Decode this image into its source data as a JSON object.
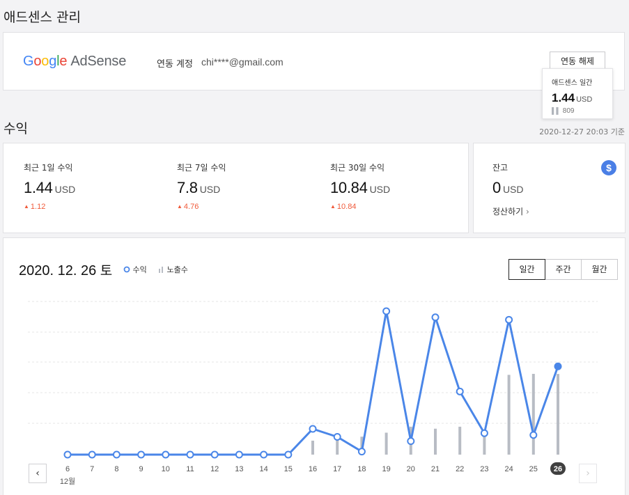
{
  "page": {
    "title": "애드센스 관리",
    "revenue_title": "수익",
    "timestamp": "2020-12-27 20:03 기준"
  },
  "account": {
    "logo_google": [
      "G",
      "o",
      "o",
      "g",
      "l",
      "e"
    ],
    "logo_product": "AdSense",
    "link_label": "연동 계정",
    "email": "chi****@gmail.com",
    "unlink_button": "연동 해제"
  },
  "stats": [
    {
      "label": "최근 1일 수익",
      "value": "1.44",
      "unit": "USD",
      "change": "1.12"
    },
    {
      "label": "최근 7일 수익",
      "value": "7.8",
      "unit": "USD",
      "change": "4.76"
    },
    {
      "label": "최근 30일 수익",
      "value": "10.84",
      "unit": "USD",
      "change": "10.84"
    }
  ],
  "balance": {
    "label": "잔고",
    "value": "0",
    "unit": "USD",
    "settle_link": "정산하기"
  },
  "chart_header": {
    "date": "2020. 12. 26",
    "weekday": "토",
    "legend_revenue": "수익",
    "legend_impressions": "노출수",
    "tabs": [
      "일간",
      "주간",
      "월간"
    ],
    "active_tab": "일간"
  },
  "tooltip": {
    "title": "애드센스 일간",
    "value": "1.44",
    "unit": "USD",
    "impressions": "809"
  },
  "colors": {
    "line": "#4a86e8",
    "impression_bar": "#b8bcc4",
    "up_change": "#f05a3a",
    "selected_day_bg": "#404040"
  },
  "chart_data": {
    "type": "line",
    "month_label": "12월",
    "selected_day": "26",
    "categories": [
      "6",
      "7",
      "8",
      "9",
      "10",
      "11",
      "12",
      "13",
      "14",
      "15",
      "16",
      "17",
      "18",
      "19",
      "20",
      "21",
      "22",
      "23",
      "24",
      "25",
      "26"
    ],
    "series": [
      {
        "name": "수익",
        "values": [
          0,
          0,
          0,
          0,
          0,
          0,
          0,
          0,
          0,
          0,
          0.42,
          0.29,
          0.05,
          2.34,
          0.22,
          2.24,
          1.03,
          0.35,
          2.2,
          0.32,
          1.44
        ]
      },
      {
        "name": "노출수",
        "values": [
          0,
          0,
          0,
          0,
          0,
          0,
          0,
          0,
          0,
          0,
          140,
          180,
          180,
          220,
          280,
          260,
          280,
          190,
          800,
          810,
          809
        ]
      }
    ],
    "grid": true
  }
}
